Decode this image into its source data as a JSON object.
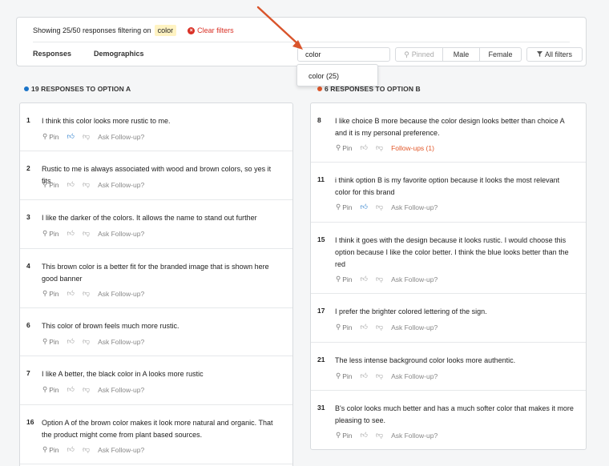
{
  "header": {
    "showing_text": "Showing 25/50 responses filtering on",
    "filter_chip": "color",
    "clear_label": "Clear filters"
  },
  "tabs": [
    "Responses",
    "Demographics"
  ],
  "search": {
    "value": "color"
  },
  "buttons": {
    "pinned": "Pinned",
    "male": "Male",
    "female": "Female",
    "all_filters": "All filters"
  },
  "dropdown": {
    "option": "color (25)"
  },
  "colors": {
    "option_a": "#1a73c8",
    "option_b": "#e2582a",
    "accent_red": "#d93025"
  },
  "column_a": {
    "heading": "19 RESPONSES TO OPTION A",
    "items": [
      {
        "num": "1",
        "text": "I think this color looks more rustic to me.",
        "pin": "Pin",
        "ask": "Ask Follow-up?"
      },
      {
        "num": "2",
        "text": "Rustic to me is always associated with wood and brown colors, so yes it fits.",
        "pin": "Pin",
        "ask": "Ask Follow-up?"
      },
      {
        "num": "3",
        "text": "I like the darker of the colors. It allows the name to stand out further",
        "pin": "Pin",
        "ask": "Ask Follow-up?"
      },
      {
        "num": "4",
        "text": "This brown color is a better fit for the branded image that is shown here good banner",
        "pin": "Pin",
        "ask": "Ask Follow-up?"
      },
      {
        "num": "6",
        "text": "This color of brown feels much more rustic.",
        "pin": "Pin",
        "ask": "Ask Follow-up?"
      },
      {
        "num": "7",
        "text": "I like A better, the black color in A looks more rustic",
        "pin": "Pin",
        "ask": "Ask Follow-up?"
      },
      {
        "num": "16",
        "text": "Option A of the brown color makes it look more natural and organic. That the product might come from plant based sources.",
        "pin": "Pin",
        "ask": "Ask Follow-up?"
      }
    ]
  },
  "column_b": {
    "heading": "6 RESPONSES TO OPTION B",
    "items": [
      {
        "num": "8",
        "text": "I like choice B more because the color design looks better than choice A and it is my personal preference.",
        "pin": "Pin",
        "ask": "Follow-ups (1)"
      },
      {
        "num": "11",
        "text": "i think option B is my favorite option because it looks the most relevant color for this brand",
        "pin": "Pin",
        "ask": "Ask Follow-up?"
      },
      {
        "num": "15",
        "text": "I think it goes with the design because it looks rustic. I would choose this option because I like the color better. I think the blue looks better than the red",
        "pin": "Pin",
        "ask": "Ask Follow-up?"
      },
      {
        "num": "17",
        "text": "I prefer the brighter colored lettering of the sign.",
        "pin": "Pin",
        "ask": "Ask Follow-up?"
      },
      {
        "num": "21",
        "text": "The less intense background color looks more authentic.",
        "pin": "Pin",
        "ask": "Ask Follow-up?"
      },
      {
        "num": "31",
        "text": "B's color looks much better and has a much softer color that makes it more pleasing to see.",
        "pin": "Pin",
        "ask": "Ask Follow-up?"
      }
    ]
  }
}
